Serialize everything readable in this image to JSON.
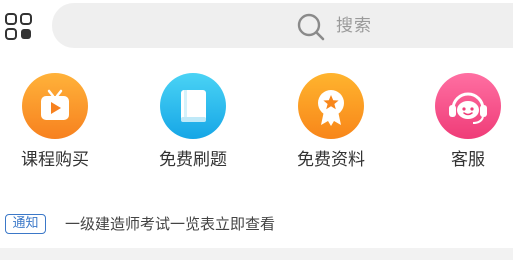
{
  "header": {
    "menu_icon": "grid-menu-icon",
    "search": {
      "icon": "search-icon",
      "placeholder": "搜索"
    }
  },
  "features": [
    {
      "label": "课程购买",
      "icon": "video-play-icon",
      "color": "#f7811f"
    },
    {
      "label": "免费刷题",
      "icon": "book-icon",
      "color": "#16a6e6"
    },
    {
      "label": "免费资料",
      "icon": "award-badge-icon",
      "color": "#f8861a"
    },
    {
      "label": "客服",
      "icon": "headset-service-icon",
      "color": "#ef3c78"
    }
  ],
  "notice": {
    "badge": "通知",
    "text": "一级建造师考试一览表立即查看"
  }
}
